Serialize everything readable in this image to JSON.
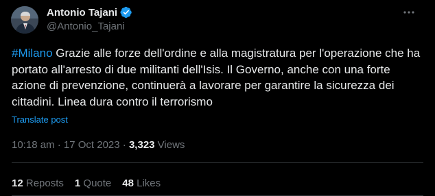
{
  "author": {
    "display_name": "Antonio Tajani",
    "handle": "@Antonio_Tajani",
    "verified_icon": "verified-badge-icon",
    "verified_color": "#1d9bf0"
  },
  "more_icon": "more-horizontal-icon",
  "post": {
    "hashtag": "#Milano",
    "text": " Grazie alle forze dell'ordine e alla magistratura per l'operazione che ha portato all'arresto di due militanti dell'Isis. Il Governo, anche con una forte azione di prevenzione, continuerà a lavorare per garantire la sicurezza dei cittadini. Linea dura contro il terrorismo",
    "translate_label": "Translate post"
  },
  "meta": {
    "time": "10:18 am",
    "separator": " · ",
    "date": "17 Oct 2023",
    "views_count": "3,323",
    "views_label": " Views"
  },
  "stats": {
    "reposts_count": "12",
    "reposts_label": " Reposts",
    "quotes_count": "1",
    "quotes_label": " Quote",
    "likes_count": "48",
    "likes_label": " Likes"
  },
  "colors": {
    "background": "#000000",
    "text": "#e7e9ea",
    "secondary": "#71767b",
    "accent": "#1d9bf0",
    "divider": "#2f3336"
  }
}
